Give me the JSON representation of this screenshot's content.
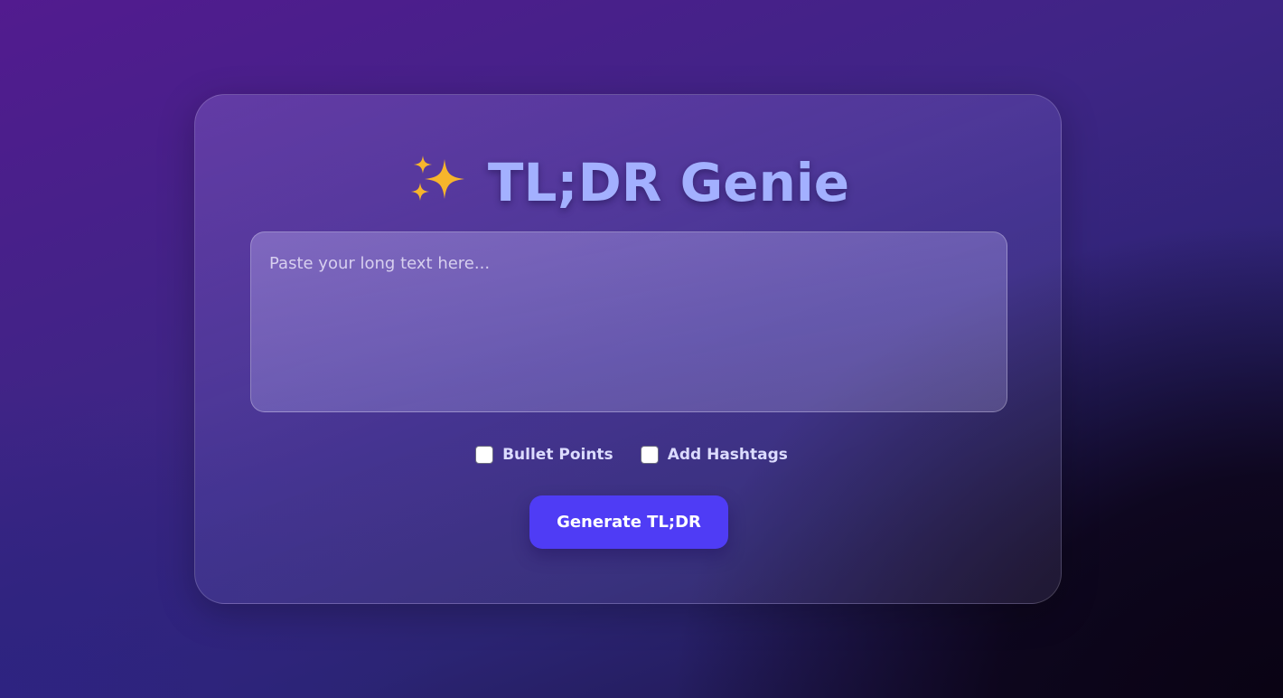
{
  "app": {
    "title": "TL;DR Genie",
    "title_icon": "sparkles-icon"
  },
  "input": {
    "placeholder": "Paste your long text here...",
    "value": ""
  },
  "options": [
    {
      "label": "Bullet Points",
      "checked": false
    },
    {
      "label": "Add Hashtags",
      "checked": false
    }
  ],
  "actions": {
    "generate_label": "Generate TL;DR"
  },
  "colors": {
    "title": "#a3b0ff",
    "accent": "#4f3cf5",
    "sparkle": "#f7b52c"
  }
}
